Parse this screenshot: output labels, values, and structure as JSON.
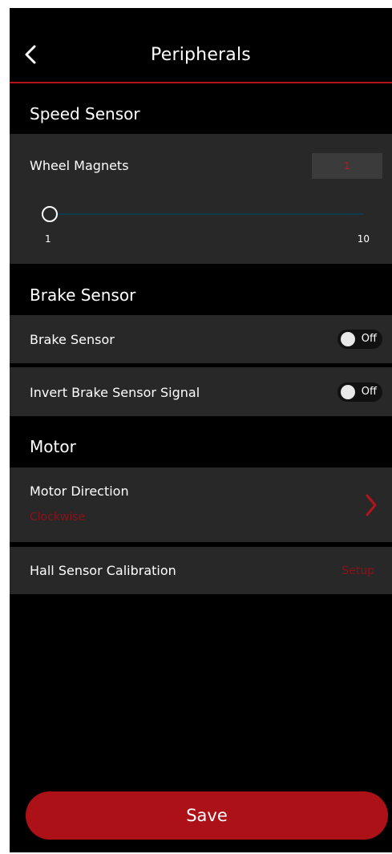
{
  "header": {
    "title": "Peripherals"
  },
  "speed_sensor": {
    "heading": "Speed Sensor",
    "wheel_magnets_label": "Wheel Magnets",
    "wheel_magnets_value": "1",
    "slider": {
      "min_label": "1",
      "max_label": "10",
      "value": 1
    }
  },
  "brake_sensor": {
    "heading": "Brake Sensor",
    "brake_sensor_label": "Brake Sensor",
    "brake_sensor_state": "Off",
    "invert_label": "Invert Brake Sensor Signal",
    "invert_state": "Off"
  },
  "motor": {
    "heading": "Motor",
    "direction_label": "Motor Direction",
    "direction_value": "Clockwise",
    "hall_label": "Hall Sensor Calibration",
    "hall_action": "Setup"
  },
  "footer": {
    "save_label": "Save"
  },
  "colors": {
    "background": "#000000",
    "card": "#282828",
    "accent": "#ad1118",
    "accent_text": "#8a1218"
  },
  "icons": {
    "back": "chevron-left-icon",
    "direction": "chevron-right-icon"
  }
}
